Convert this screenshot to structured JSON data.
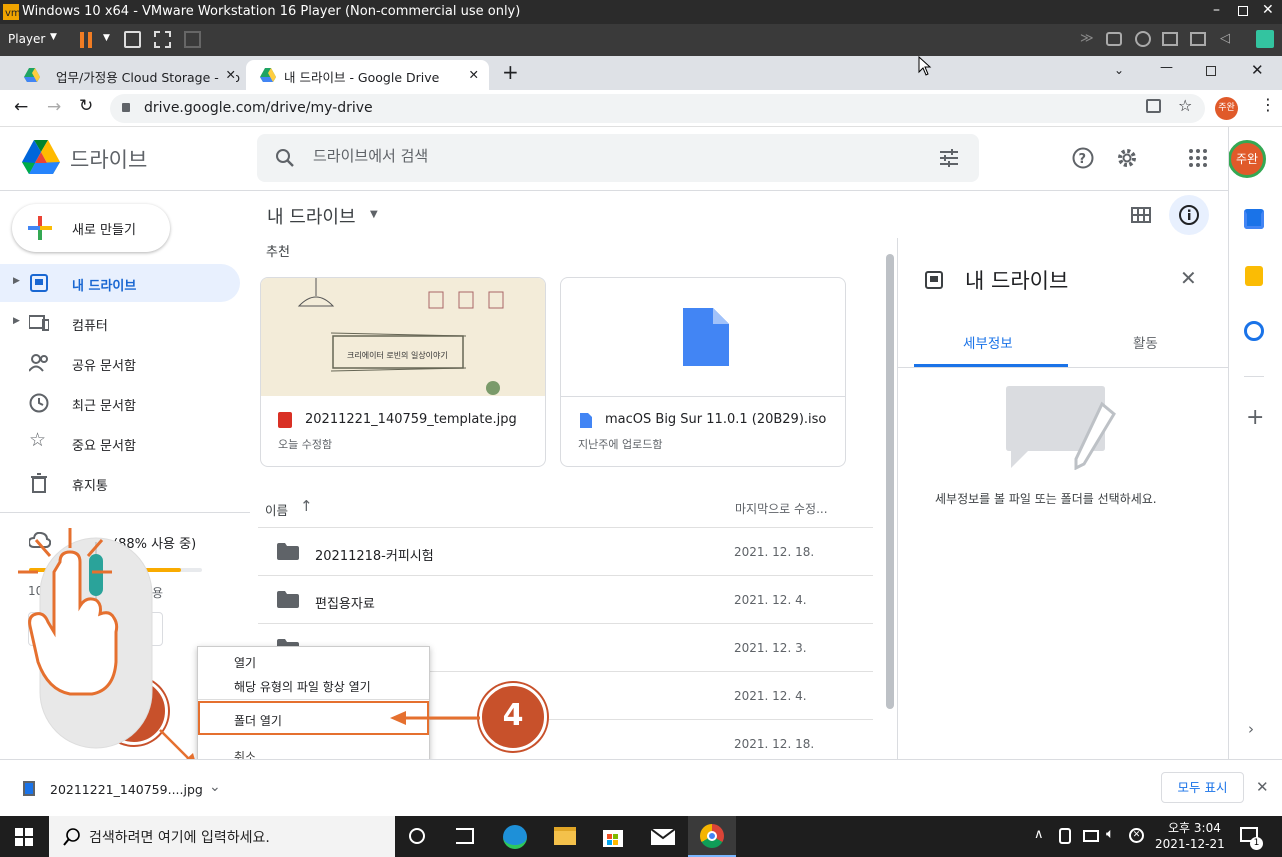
{
  "vmware": {
    "title": "Windows 10 x64 - VMware Workstation 16 Player (Non-commercial use only)",
    "player_menu": "Player"
  },
  "chrome": {
    "tabs": [
      {
        "label": "업무/가정용 Cloud Storage - Go"
      },
      {
        "label": "내 드라이브 - Google Drive"
      }
    ],
    "url": "drive.google.com/drive/my-drive",
    "profile": "주완"
  },
  "drive": {
    "logo_text": "드라이브",
    "search_placeholder": "드라이브에서 검색",
    "avatar": "주완",
    "new_button": "새로 만들기",
    "nav": [
      {
        "label": "내 드라이브"
      },
      {
        "label": "컴퓨터"
      },
      {
        "label": "공유 문서함"
      },
      {
        "label": "최근 문서함"
      },
      {
        "label": "중요 문서함"
      },
      {
        "label": "휴지통"
      }
    ],
    "storage_text": "(88% 사용 중)",
    "storage_fraction": 0.88,
    "storage_sub_left": "10",
    "storage_sub_right": "용",
    "breadcrumb": "내 드라이브",
    "suggested_label": "추천",
    "cards": [
      {
        "name": "20211221_140759_template.jpg",
        "sub": "오늘 수정함",
        "thumb_text": "크리에이터 로빈의 일상이야기"
      },
      {
        "name": "macOS Big Sur 11.0.1 (20B29).iso",
        "sub": "지난주에 업로드함"
      }
    ],
    "list_header": {
      "name": "이름",
      "modified": "마지막으로 수정..."
    },
    "rows": [
      {
        "name": "20211218-커피시험",
        "date": "2021. 12. 18."
      },
      {
        "name": "편집용자료",
        "date": "2021. 12. 4."
      },
      {
        "name": "",
        "date": "2021. 12. 3."
      },
      {
        "name": "",
        "date": "2021. 12. 4."
      },
      {
        "name": "",
        "date": "2021. 12. 18."
      }
    ],
    "details": {
      "title": "내 드라이브",
      "tab_details": "세부정보",
      "tab_activity": "활동",
      "empty_text": "세부정보를 볼 파일 또는 폴더를 선택하세요."
    }
  },
  "context_menu": {
    "items": [
      "열기",
      "해당 유형의 파일 항상 열기",
      "폴더 열기",
      "취소"
    ]
  },
  "annotations": {
    "step3": "3",
    "step4": "4"
  },
  "download_bar": {
    "filename": "20211221_140759....jpg",
    "show_all": "모두 표시"
  },
  "taskbar": {
    "search_placeholder": "검색하려면 여기에 입력하세요.",
    "time": "오후 3:04",
    "date": "2021-12-21",
    "notif_count": "1"
  },
  "colors": {
    "accent_blue": "#1a73e8",
    "orange": "#e5702f",
    "selected_nav": "#e8f0fe"
  }
}
